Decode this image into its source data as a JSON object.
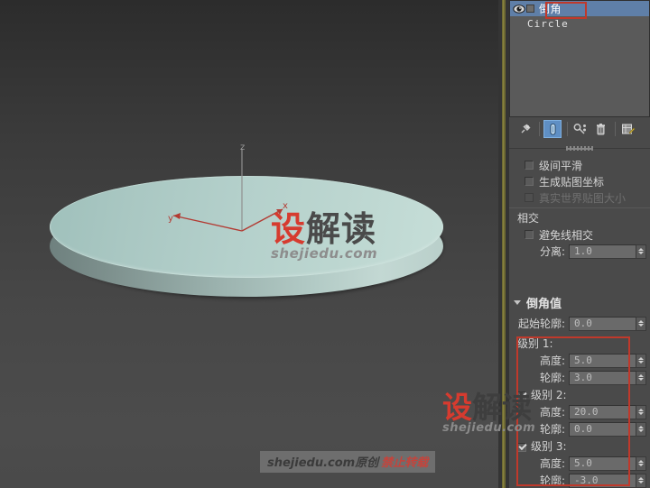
{
  "viewport": {
    "axis": {
      "z_label": "z",
      "y_label": "y",
      "x_label": "x"
    },
    "watermark": {
      "brand_red": "设",
      "brand_dark": "解读",
      "site": "shejiedu.com"
    },
    "banner": {
      "text": "shejiedu.com原创",
      "notice": "禁止转载"
    }
  },
  "panel": {
    "stack": {
      "rows": [
        {
          "label": "倒角",
          "selected": true,
          "has_eye": true
        },
        {
          "label": "Circle",
          "selected": false,
          "has_eye": false
        }
      ]
    },
    "stack_tools": [
      {
        "name": "pin-stack-icon",
        "title": "固定堆栈"
      },
      {
        "name": "show-end-result-icon",
        "title": "显示最终结果",
        "active": true
      },
      {
        "name": "make-unique-icon",
        "title": "使唯一"
      },
      {
        "name": "remove-modifier-icon",
        "title": "从堆栈中移除修改器"
      },
      {
        "name": "configure-modifier-sets-icon",
        "title": "配置修改器集"
      }
    ],
    "parameters": {
      "checkboxes": [
        {
          "label": "级间平滑",
          "checked": false,
          "disabled": false
        },
        {
          "label": "生成贴图坐标",
          "checked": false,
          "disabled": false
        },
        {
          "label": "真实世界贴图大小",
          "checked": false,
          "disabled": true
        }
      ],
      "intersect_group": {
        "title": "相交",
        "avoid_label": "避免线相交",
        "avoid_checked": false,
        "separation_label": "分离:",
        "separation_value": "1.0"
      }
    },
    "bevel_values": {
      "title": "倒角值",
      "start_outline_label": "起始轮廓:",
      "start_outline_value": "0.0",
      "levels": [
        {
          "title": "级别 1:",
          "has_checkbox": false,
          "checked": true,
          "height_label": "高度:",
          "height_value": "5.0",
          "outline_label": "轮廓:",
          "outline_value": "3.0"
        },
        {
          "title": "级别 2:",
          "has_checkbox": true,
          "checked": true,
          "height_label": "高度:",
          "height_value": "20.0",
          "outline_label": "轮廓:",
          "outline_value": "0.0"
        },
        {
          "title": "级别 3:",
          "has_checkbox": true,
          "checked": true,
          "height_label": "高度:",
          "height_value": "5.0",
          "outline_label": "轮廓:",
          "outline_value": "-3.0"
        }
      ]
    },
    "watermark": {
      "brand_red": "设",
      "brand_dark": "解读",
      "site": "shejiedu.com"
    }
  },
  "colors": {
    "annotation_red": "#c0392b",
    "panel_bg": "#4a4a4a",
    "stack_selected": "#5f7fa8",
    "divider_olive": "#6e6a33",
    "mesh_top": "#b4d0cb",
    "mesh_side": "#7e918e",
    "axis_red": "#b33a32"
  }
}
